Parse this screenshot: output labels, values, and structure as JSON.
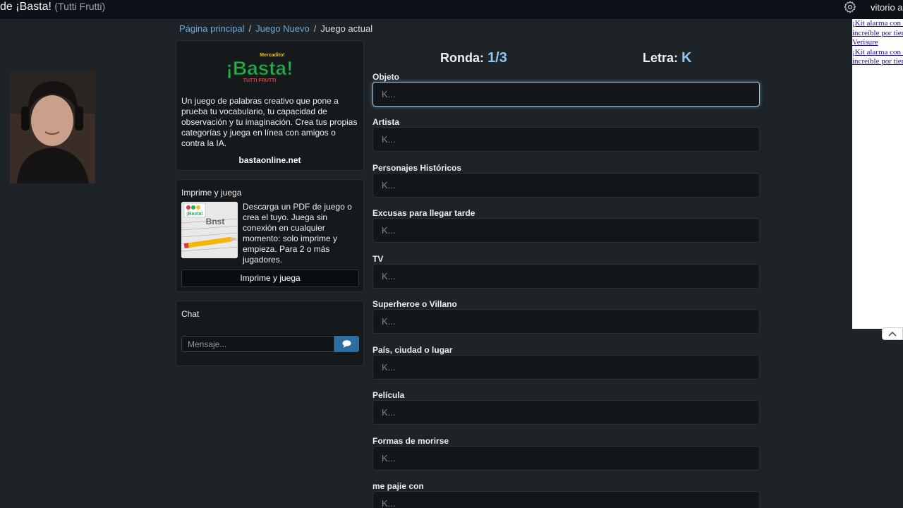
{
  "header": {
    "site_title": "de ¡Basta!",
    "site_subtitle": "(Tutti Frutti)",
    "username": "vitorio ale"
  },
  "breadcrumb": {
    "home": "Página principal",
    "new_game": "Juego Nuevo",
    "current": "Juego actual"
  },
  "about": {
    "logo_small": "Mercadito!",
    "logo_main": "¡Basta!",
    "logo_sub": "TUTTI FRUTTI",
    "description": "Un juego de palabras creativo que pone a prueba tu vocabulario, tu capacidad de observación y tu imaginación. Crea tus propias categorías y juega en línea con amigos o contra la IA.",
    "site": "bastaonline.net"
  },
  "print": {
    "title": "Imprime y juega",
    "description": "Descarga un PDF de juego o crea el tuyo. Juega sin conexión en cualquier momento: solo imprime y empieza. Para 2 o más jugadores.",
    "button": "Imprime y juega"
  },
  "chat": {
    "title": "Chat",
    "placeholder": "Mensaje..."
  },
  "game": {
    "round_label": "Ronda:",
    "round_value": "1/3",
    "letter_label": "Letra:",
    "letter_value": "K",
    "categories": [
      {
        "label": "Objeto",
        "placeholder": "K..."
      },
      {
        "label": "Artista",
        "placeholder": "K..."
      },
      {
        "label": "Personajes Históricos",
        "placeholder": "K..."
      },
      {
        "label": "Excusas para llegar tarde",
        "placeholder": "K..."
      },
      {
        "label": "TV",
        "placeholder": "K..."
      },
      {
        "label": "Superheroe o Villano",
        "placeholder": "K..."
      },
      {
        "label": "País, ciudad o lugar",
        "placeholder": "K..."
      },
      {
        "label": "Película",
        "placeholder": "K..."
      },
      {
        "label": "Formas de morirse",
        "placeholder": "K..."
      },
      {
        "label": "me pajie con",
        "placeholder": "K..."
      }
    ]
  },
  "ad": {
    "line1": "¡Kit alarma con cámara Wi-Fi: ¡Precio increíble por tiempo limitado!",
    "line2": "Verisure",
    "line3": "¡Kit alarma con cámara Wi-Fi: ¡Precio increíble por tiempo limitado!"
  },
  "colors": {
    "accent": "#8ec5f2",
    "link": "#6ea8d8",
    "send_button": "#2e6da4",
    "background": "#1d2326"
  }
}
